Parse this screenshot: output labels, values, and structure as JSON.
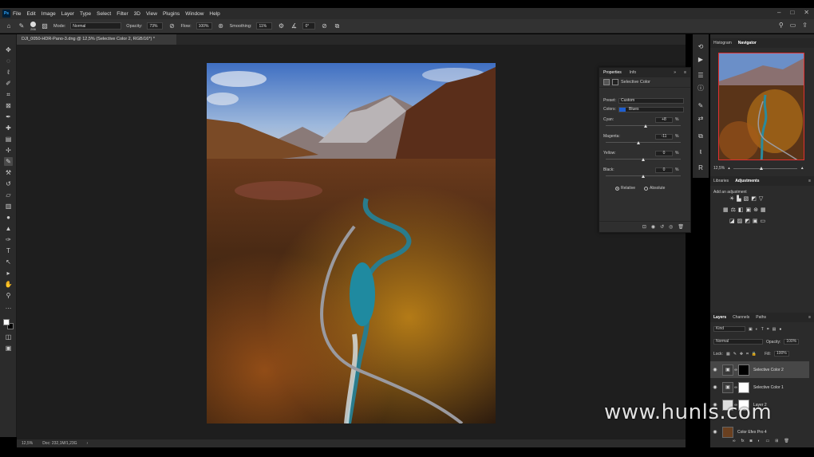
{
  "menubar": {
    "logo": "Ps",
    "items": [
      "File",
      "Edit",
      "Image",
      "Layer",
      "Type",
      "Select",
      "Filter",
      "3D",
      "View",
      "Plugins",
      "Window",
      "Help"
    ],
    "window_controls": [
      "–",
      "□",
      "✕"
    ]
  },
  "options": {
    "brush_size": "266",
    "mode_label": "Mode:",
    "mode_value": "Normal",
    "opacity_label": "Opacity:",
    "opacity_value": "73%",
    "flow_label": "Flow:",
    "flow_value": "100%",
    "smoothing_label": "Smoothing:",
    "smoothing_value": "11%",
    "angle_value": "0°"
  },
  "document": {
    "tab_title": "DJI_0050-HDR-Pano-3.dng @ 12,5% (Selective Color 2, RGB/16*) *",
    "zoom": "12,5%",
    "doc_info": "Doc: 232,1M/1,23G"
  },
  "properties": {
    "tabs": [
      "Properties",
      "Info"
    ],
    "title": "Selective Color",
    "preset_label": "Preset:",
    "preset_value": "Custom",
    "colors_label": "Colors:",
    "colors_value": "Blues",
    "colors_swatch": "#1f5fd0",
    "sliders": [
      {
        "label": "Cyan:",
        "value": "+8",
        "fraction": 0.54
      },
      {
        "label": "Magenta:",
        "value": "-11",
        "fraction": 0.44
      },
      {
        "label": "Yellow:",
        "value": "0",
        "fraction": 0.5
      },
      {
        "label": "Black:",
        "value": "0",
        "fraction": 0.5
      }
    ],
    "percent": "%",
    "method_relative": "Relative",
    "method_absolute": "Absolute"
  },
  "navigator": {
    "tabs": [
      "Histogram",
      "Navigator"
    ],
    "zoom": "12,5%"
  },
  "adjustments": {
    "tabs": [
      "Libraries",
      "Adjustments"
    ],
    "add_label": "Add an adjustment"
  },
  "layers": {
    "tabs": [
      "Layers",
      "Channels",
      "Paths"
    ],
    "kind_label": "Kind",
    "blend_mode": "Normal",
    "opacity_label": "Opacity:",
    "opacity_value": "100%",
    "lock_label": "Lock:",
    "fill_label": "Fill:",
    "fill_value": "100%",
    "rows": [
      {
        "name": "Selective Color 2"
      },
      {
        "name": "Selective Color 1"
      },
      {
        "name": "Layer 2"
      },
      {
        "name": "Color Efex Pro 4"
      }
    ]
  },
  "watermark": "www.hunls.com"
}
